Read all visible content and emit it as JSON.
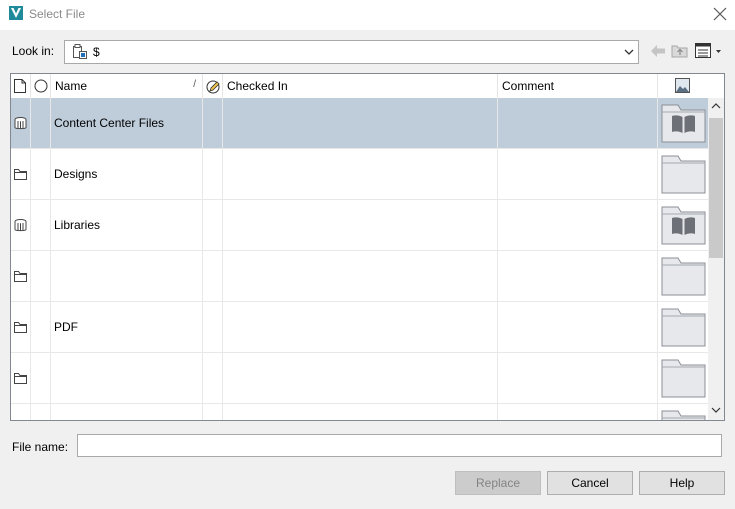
{
  "window": {
    "title": "Select File"
  },
  "look_in": {
    "label": "Look in:",
    "value": "$"
  },
  "columns": [
    {
      "label": ""
    },
    {
      "label": ""
    },
    {
      "label": "Name",
      "sort_indicator": "/"
    },
    {
      "label": ""
    },
    {
      "label": "Checked In"
    },
    {
      "label": "Comment"
    },
    {
      "label": ""
    }
  ],
  "rows": [
    {
      "name": "Content Center Files",
      "type": "library",
      "thumbnail": "book",
      "selected": true
    },
    {
      "name": "Designs",
      "type": "folder",
      "thumbnail": "folder",
      "selected": false
    },
    {
      "name": "Libraries",
      "type": "library",
      "thumbnail": "book",
      "selected": false
    },
    {
      "name": "",
      "type": "folder",
      "thumbnail": "folder",
      "selected": false
    },
    {
      "name": "PDF",
      "type": "folder",
      "thumbnail": "folder",
      "selected": false
    },
    {
      "name": "",
      "type": "folder",
      "thumbnail": "folder",
      "selected": false
    },
    {
      "name": "",
      "type": "folder",
      "thumbnail": "folder",
      "selected": false
    }
  ],
  "file_name": {
    "label": "File name:",
    "value": "",
    "placeholder": ""
  },
  "buttons": {
    "replace": "Replace",
    "cancel": "Cancel",
    "help": "Help"
  },
  "colors": {
    "selection": "#bfcddb",
    "accent": "#1e6fb8"
  }
}
